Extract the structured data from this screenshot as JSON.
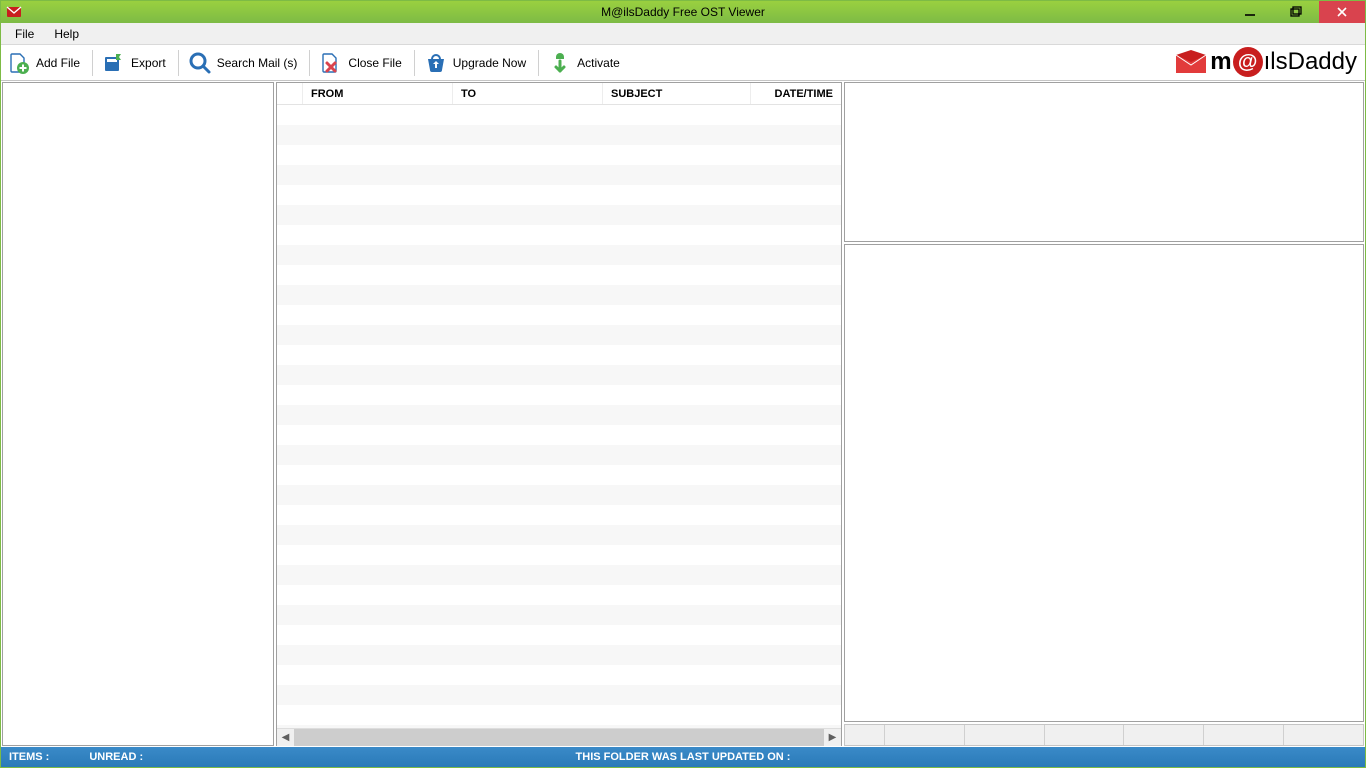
{
  "window": {
    "title": "M@ilsDaddy Free OST Viewer"
  },
  "menu": {
    "file": "File",
    "help": "Help"
  },
  "toolbar": {
    "add_file": "Add File",
    "export": "Export",
    "search_mail": "Search Mail (s)",
    "close_file": "Close File",
    "upgrade_now": "Upgrade Now",
    "activate": "Activate"
  },
  "brand": {
    "m": "m",
    "at": "@",
    "ls": "ılsDaddy"
  },
  "grid": {
    "headers": {
      "from": "FROM",
      "to": "TO",
      "subject": "SUBJECT",
      "datetime": "DATE/TIME"
    }
  },
  "status": {
    "items_label": "ITEMS :",
    "unread_label": "UNREAD :",
    "folder_updated": "THIS FOLDER WAS LAST UPDATED ON :"
  }
}
